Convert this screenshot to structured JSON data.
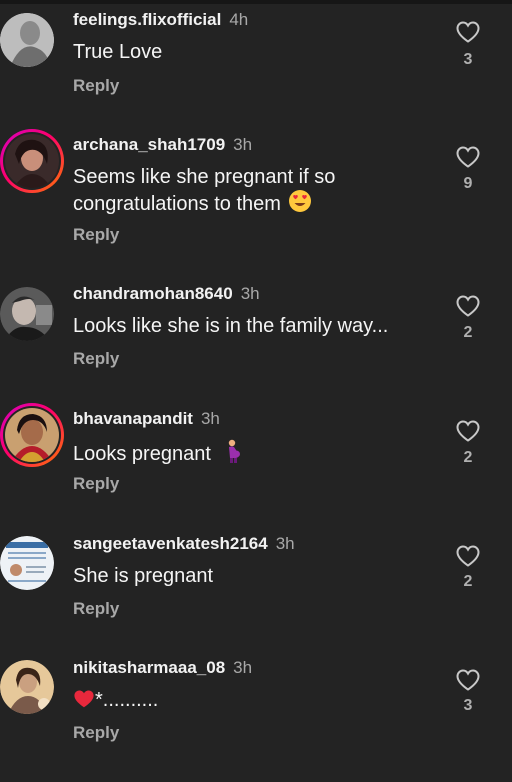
{
  "comments": [
    {
      "username": "feelings.flixofficial",
      "time": "4h",
      "text": "True Love",
      "reply": "Reply",
      "likes": "3"
    },
    {
      "username": "archana_shah1709",
      "time": "3h",
      "text_line1": "Seems like she pregnant if so",
      "text_line2": "congratulations to them",
      "emoji": "heart-eyes-emoji",
      "reply": "Reply",
      "likes": "9"
    },
    {
      "username": "chandramohan8640",
      "time": "3h",
      "text": "Looks like she is in the family way...",
      "reply": "Reply",
      "likes": "2"
    },
    {
      "username": "bhavanapandit",
      "time": "3h",
      "text": "Looks pregnant",
      "emoji": "pregnant-woman-emoji",
      "reply": "Reply",
      "likes": "2"
    },
    {
      "username": "sangeetavenkatesh2164",
      "time": "3h",
      "text": "She is pregnant",
      "reply": "Reply",
      "likes": "2"
    },
    {
      "username": "nikitasharmaaa_08",
      "time": "3h",
      "emoji": "red-heart-emoji",
      "text": "*..........",
      "reply": "Reply",
      "likes": "3"
    }
  ],
  "colors": {
    "background": "#232323",
    "text": "#f5f5f5",
    "secondary": "#a8a8a8",
    "story_ring_start": "#d300c5",
    "story_ring_end": "#ff7a00"
  },
  "icons": {
    "like": "heart-outline-icon"
  }
}
